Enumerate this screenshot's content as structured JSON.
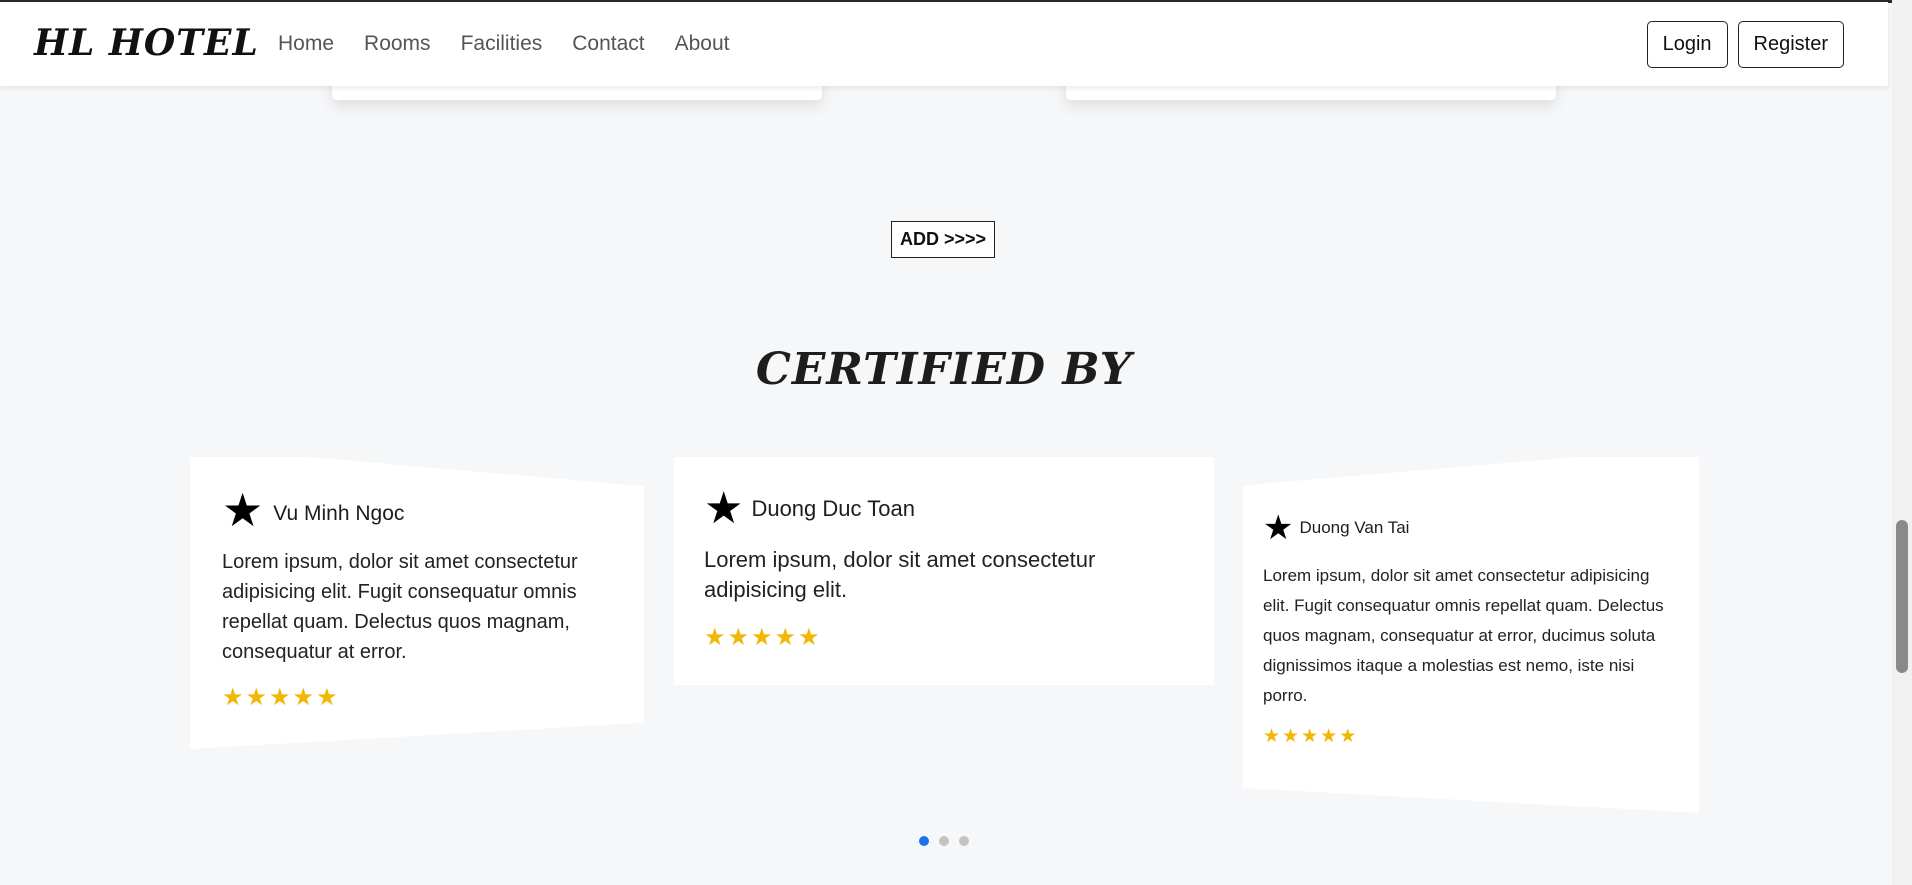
{
  "navbar": {
    "brand": "HL HOTEL",
    "links": [
      "Home",
      "Rooms",
      "Facilities",
      "Contact",
      "About"
    ],
    "login_label": "Login",
    "register_label": "Register"
  },
  "add_button_label": "ADD >>>>",
  "section_title": "CERTIFIED BY",
  "testimonials": [
    {
      "name": "Vu Minh Ngoc",
      "text": "Lorem ipsum, dolor sit amet consectetur adipisicing elit. Fugit consequatur omnis repellat quam. Delectus quos magnam, consequatur at error.",
      "rating": 5
    },
    {
      "name": "Duong Duc Toan",
      "text": "Lorem ipsum, dolor sit amet consectetur adipisicing elit.",
      "rating": 5
    },
    {
      "name": "Duong Van Tai",
      "text": "Lorem ipsum, dolor sit amet consectetur adipisicing elit. Fugit consequatur omnis repellat quam. Delectus quos magnam, consequatur at error, ducimus soluta dignissimos itaque a molestias est nemo, iste nisi porro.",
      "rating": 5
    }
  ],
  "carousel": {
    "dot_count": 3,
    "active_index": 0
  },
  "colors": {
    "accent": "#1a73e8",
    "star_rating": "#f2b705",
    "page_background": "#f6f7f9"
  },
  "icons": {
    "card_icon": "star-icon",
    "rating_icon": "rating-star-icon"
  }
}
